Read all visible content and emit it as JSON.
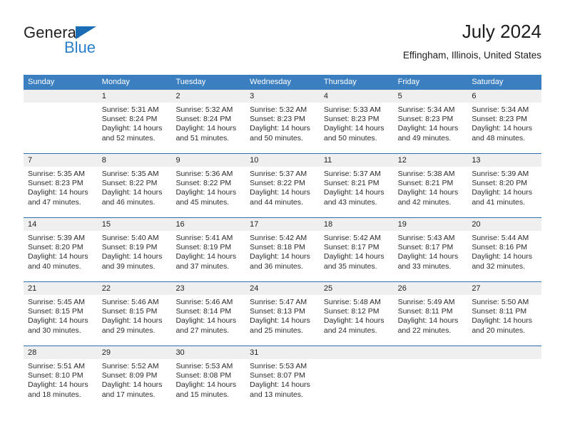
{
  "brand": {
    "name_top": "General",
    "name_bottom": "Blue",
    "accent_color": "#2a7fc9",
    "triangle_color": "#1a6cb5"
  },
  "header": {
    "title": "July 2024",
    "subtitle": "Effingham, Illinois, United States"
  },
  "theme": {
    "header_bg": "#3c7fc0",
    "week_rule": "#2f6fae",
    "daynum_band": "#efefef",
    "cell_bg": "#ffffff"
  },
  "weekdays": [
    "Sunday",
    "Monday",
    "Tuesday",
    "Wednesday",
    "Thursday",
    "Friday",
    "Saturday"
  ],
  "weeks": [
    {
      "days": [
        {
          "num": "",
          "sunrise": "",
          "sunset": "",
          "daylight1": "",
          "daylight2": "",
          "empty": true
        },
        {
          "num": "1",
          "sunrise": "Sunrise: 5:31 AM",
          "sunset": "Sunset: 8:24 PM",
          "daylight1": "Daylight: 14 hours",
          "daylight2": "and 52 minutes."
        },
        {
          "num": "2",
          "sunrise": "Sunrise: 5:32 AM",
          "sunset": "Sunset: 8:24 PM",
          "daylight1": "Daylight: 14 hours",
          "daylight2": "and 51 minutes."
        },
        {
          "num": "3",
          "sunrise": "Sunrise: 5:32 AM",
          "sunset": "Sunset: 8:23 PM",
          "daylight1": "Daylight: 14 hours",
          "daylight2": "and 50 minutes."
        },
        {
          "num": "4",
          "sunrise": "Sunrise: 5:33 AM",
          "sunset": "Sunset: 8:23 PM",
          "daylight1": "Daylight: 14 hours",
          "daylight2": "and 50 minutes."
        },
        {
          "num": "5",
          "sunrise": "Sunrise: 5:34 AM",
          "sunset": "Sunset: 8:23 PM",
          "daylight1": "Daylight: 14 hours",
          "daylight2": "and 49 minutes."
        },
        {
          "num": "6",
          "sunrise": "Sunrise: 5:34 AM",
          "sunset": "Sunset: 8:23 PM",
          "daylight1": "Daylight: 14 hours",
          "daylight2": "and 48 minutes."
        }
      ]
    },
    {
      "days": [
        {
          "num": "7",
          "sunrise": "Sunrise: 5:35 AM",
          "sunset": "Sunset: 8:23 PM",
          "daylight1": "Daylight: 14 hours",
          "daylight2": "and 47 minutes."
        },
        {
          "num": "8",
          "sunrise": "Sunrise: 5:35 AM",
          "sunset": "Sunset: 8:22 PM",
          "daylight1": "Daylight: 14 hours",
          "daylight2": "and 46 minutes."
        },
        {
          "num": "9",
          "sunrise": "Sunrise: 5:36 AM",
          "sunset": "Sunset: 8:22 PM",
          "daylight1": "Daylight: 14 hours",
          "daylight2": "and 45 minutes."
        },
        {
          "num": "10",
          "sunrise": "Sunrise: 5:37 AM",
          "sunset": "Sunset: 8:22 PM",
          "daylight1": "Daylight: 14 hours",
          "daylight2": "and 44 minutes."
        },
        {
          "num": "11",
          "sunrise": "Sunrise: 5:37 AM",
          "sunset": "Sunset: 8:21 PM",
          "daylight1": "Daylight: 14 hours",
          "daylight2": "and 43 minutes."
        },
        {
          "num": "12",
          "sunrise": "Sunrise: 5:38 AM",
          "sunset": "Sunset: 8:21 PM",
          "daylight1": "Daylight: 14 hours",
          "daylight2": "and 42 minutes."
        },
        {
          "num": "13",
          "sunrise": "Sunrise: 5:39 AM",
          "sunset": "Sunset: 8:20 PM",
          "daylight1": "Daylight: 14 hours",
          "daylight2": "and 41 minutes."
        }
      ]
    },
    {
      "days": [
        {
          "num": "14",
          "sunrise": "Sunrise: 5:39 AM",
          "sunset": "Sunset: 8:20 PM",
          "daylight1": "Daylight: 14 hours",
          "daylight2": "and 40 minutes."
        },
        {
          "num": "15",
          "sunrise": "Sunrise: 5:40 AM",
          "sunset": "Sunset: 8:19 PM",
          "daylight1": "Daylight: 14 hours",
          "daylight2": "and 39 minutes."
        },
        {
          "num": "16",
          "sunrise": "Sunrise: 5:41 AM",
          "sunset": "Sunset: 8:19 PM",
          "daylight1": "Daylight: 14 hours",
          "daylight2": "and 37 minutes."
        },
        {
          "num": "17",
          "sunrise": "Sunrise: 5:42 AM",
          "sunset": "Sunset: 8:18 PM",
          "daylight1": "Daylight: 14 hours",
          "daylight2": "and 36 minutes."
        },
        {
          "num": "18",
          "sunrise": "Sunrise: 5:42 AM",
          "sunset": "Sunset: 8:17 PM",
          "daylight1": "Daylight: 14 hours",
          "daylight2": "and 35 minutes."
        },
        {
          "num": "19",
          "sunrise": "Sunrise: 5:43 AM",
          "sunset": "Sunset: 8:17 PM",
          "daylight1": "Daylight: 14 hours",
          "daylight2": "and 33 minutes."
        },
        {
          "num": "20",
          "sunrise": "Sunrise: 5:44 AM",
          "sunset": "Sunset: 8:16 PM",
          "daylight1": "Daylight: 14 hours",
          "daylight2": "and 32 minutes."
        }
      ]
    },
    {
      "days": [
        {
          "num": "21",
          "sunrise": "Sunrise: 5:45 AM",
          "sunset": "Sunset: 8:15 PM",
          "daylight1": "Daylight: 14 hours",
          "daylight2": "and 30 minutes."
        },
        {
          "num": "22",
          "sunrise": "Sunrise: 5:46 AM",
          "sunset": "Sunset: 8:15 PM",
          "daylight1": "Daylight: 14 hours",
          "daylight2": "and 29 minutes."
        },
        {
          "num": "23",
          "sunrise": "Sunrise: 5:46 AM",
          "sunset": "Sunset: 8:14 PM",
          "daylight1": "Daylight: 14 hours",
          "daylight2": "and 27 minutes."
        },
        {
          "num": "24",
          "sunrise": "Sunrise: 5:47 AM",
          "sunset": "Sunset: 8:13 PM",
          "daylight1": "Daylight: 14 hours",
          "daylight2": "and 25 minutes."
        },
        {
          "num": "25",
          "sunrise": "Sunrise: 5:48 AM",
          "sunset": "Sunset: 8:12 PM",
          "daylight1": "Daylight: 14 hours",
          "daylight2": "and 24 minutes."
        },
        {
          "num": "26",
          "sunrise": "Sunrise: 5:49 AM",
          "sunset": "Sunset: 8:11 PM",
          "daylight1": "Daylight: 14 hours",
          "daylight2": "and 22 minutes."
        },
        {
          "num": "27",
          "sunrise": "Sunrise: 5:50 AM",
          "sunset": "Sunset: 8:11 PM",
          "daylight1": "Daylight: 14 hours",
          "daylight2": "and 20 minutes."
        }
      ]
    },
    {
      "days": [
        {
          "num": "28",
          "sunrise": "Sunrise: 5:51 AM",
          "sunset": "Sunset: 8:10 PM",
          "daylight1": "Daylight: 14 hours",
          "daylight2": "and 18 minutes."
        },
        {
          "num": "29",
          "sunrise": "Sunrise: 5:52 AM",
          "sunset": "Sunset: 8:09 PM",
          "daylight1": "Daylight: 14 hours",
          "daylight2": "and 17 minutes."
        },
        {
          "num": "30",
          "sunrise": "Sunrise: 5:53 AM",
          "sunset": "Sunset: 8:08 PM",
          "daylight1": "Daylight: 14 hours",
          "daylight2": "and 15 minutes."
        },
        {
          "num": "31",
          "sunrise": "Sunrise: 5:53 AM",
          "sunset": "Sunset: 8:07 PM",
          "daylight1": "Daylight: 14 hours",
          "daylight2": "and 13 minutes."
        },
        {
          "num": "",
          "sunrise": "",
          "sunset": "",
          "daylight1": "",
          "daylight2": "",
          "empty": true
        },
        {
          "num": "",
          "sunrise": "",
          "sunset": "",
          "daylight1": "",
          "daylight2": "",
          "empty": true
        },
        {
          "num": "",
          "sunrise": "",
          "sunset": "",
          "daylight1": "",
          "daylight2": "",
          "empty": true
        }
      ]
    }
  ]
}
